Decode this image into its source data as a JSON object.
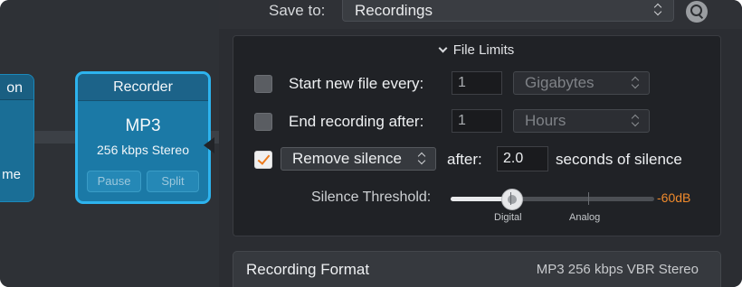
{
  "canvas": {
    "partial_node": {
      "title": "on",
      "subtitle": "me"
    },
    "recorder_node": {
      "title": "Recorder",
      "format": "MP3",
      "bitrate": "256 kbps Stereo",
      "pause_label": "Pause",
      "split_label": "Split"
    }
  },
  "panel": {
    "save_to": {
      "label": "Save to:",
      "value": "Recordings",
      "search_icon": "search-icon"
    },
    "file_limits": {
      "header": "File Limits",
      "start_new_file": {
        "checked": false,
        "label": "Start new file every:",
        "value": "1",
        "unit": "Gigabytes"
      },
      "end_recording": {
        "checked": false,
        "label": "End recording after:",
        "value": "1",
        "unit": "Hours"
      },
      "remove_silence": {
        "checked": true,
        "mode": "Remove silence",
        "after_label": "after:",
        "value": "2.0",
        "suffix": "seconds of silence"
      },
      "silence_threshold": {
        "label": "Silence Threshold:",
        "level": 0.3,
        "marks": [
          "Digital",
          "Analog"
        ],
        "value_text": "-60dB",
        "value_color": "#f08a2c"
      }
    },
    "recording_format": {
      "title": "Recording Format",
      "value": "MP3 256 kbps VBR Stereo"
    }
  },
  "colors": {
    "accent_blue": "#2db3ee",
    "node_body": "#1b79a6",
    "checkbox_check": "#ec7a1c"
  }
}
